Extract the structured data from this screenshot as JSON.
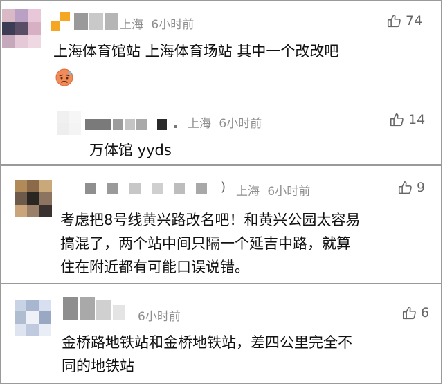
{
  "comments": [
    {
      "location": "上海",
      "time": "6小时前",
      "likes": "74",
      "text": "上海体育馆站 上海体育场站 其中一个改改吧",
      "emoji": "sweat-face-icon",
      "reply": {
        "location": "上海",
        "time": "6小时前",
        "likes": "14",
        "text": "万体馆 yyds"
      }
    },
    {
      "location": "上海",
      "time": "6小时前",
      "likes": "9",
      "lines": [
        "考虑把8号线黄兴路改名吧！和黄兴公园太容易",
        "搞混了，两个站中间只隔一个延吉中路，就算",
        "住在附近都有可能口误说错。"
      ]
    },
    {
      "time": "6小时前",
      "likes": "6",
      "lines": [
        "金桥路地铁站和金桥地铁站，差四公里完全不",
        "同的地铁站"
      ]
    }
  ],
  "colors": {
    "meta": "#8e8e8e",
    "text": "#111111",
    "border": "#9a9a9a",
    "accent_orange": "#f5a623"
  },
  "icons": {
    "like": "thumbs-up-icon"
  }
}
